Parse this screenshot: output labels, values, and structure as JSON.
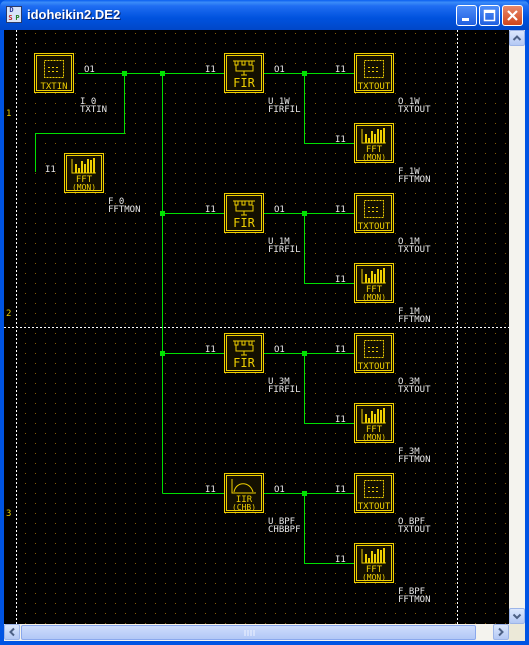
{
  "window": {
    "title": "idoheikin2.DE2"
  },
  "rulers": {
    "rows": [
      "1",
      "2",
      "3"
    ]
  },
  "blocks": [
    {
      "id": "txtin",
      "icon": "TXTIN",
      "name": "I_0",
      "type": "TXTIN",
      "in_port": "",
      "out_port": "O1"
    },
    {
      "id": "fft0",
      "icon_top": "FFT",
      "icon_sub": "(MON)",
      "name": "F_0",
      "type": "FFTMON",
      "in_port": "I1",
      "out_port": ""
    },
    {
      "id": "fir1w",
      "icon": "FIR",
      "name": "U_1W",
      "type": "FIRFIL",
      "in_port": "I1",
      "out_port": "O1"
    },
    {
      "id": "txt1w",
      "icon": "TXTOUT",
      "name": "O_1W",
      "type": "TXTOUT",
      "in_port": "I1",
      "out_port": ""
    },
    {
      "id": "fft1w",
      "icon_top": "FFT",
      "icon_sub": "(MON)",
      "name": "F_1W",
      "type": "FFTMON",
      "in_port": "I1",
      "out_port": ""
    },
    {
      "id": "fir1m",
      "icon": "FIR",
      "name": "U_1M",
      "type": "FIRFIL",
      "in_port": "I1",
      "out_port": "O1"
    },
    {
      "id": "txt1m",
      "icon": "TXTOUT",
      "name": "O_1M",
      "type": "TXTOUT",
      "in_port": "I1",
      "out_port": ""
    },
    {
      "id": "fft1m",
      "icon_top": "FFT",
      "icon_sub": "(MON)",
      "name": "F_1M",
      "type": "FFTMON",
      "in_port": "I1",
      "out_port": ""
    },
    {
      "id": "fir3m",
      "icon": "FIR",
      "name": "U_3M",
      "type": "FIRFIL",
      "in_port": "I1",
      "out_port": "O1"
    },
    {
      "id": "txt3m",
      "icon": "TXTOUT",
      "name": "O_3M",
      "type": "TXTOUT",
      "in_port": "I1",
      "out_port": ""
    },
    {
      "id": "fft3m",
      "icon_top": "FFT",
      "icon_sub": "(MON)",
      "name": "F_3M",
      "type": "FFTMON",
      "in_port": "I1",
      "out_port": ""
    },
    {
      "id": "iir",
      "icon_top": "IIR",
      "icon_sub": "(CHB)",
      "name": "U_BPF",
      "type": "CHBBPF",
      "in_port": "I1",
      "out_port": "O1"
    },
    {
      "id": "txtbpf",
      "icon": "TXTOUT",
      "name": "O_BPF",
      "type": "TXTOUT",
      "in_port": "I1",
      "out_port": ""
    },
    {
      "id": "fftbpf",
      "icon_top": "FFT",
      "icon_sub": "(MON)",
      "name": "F_BPF",
      "type": "FFTMON",
      "in_port": "I1",
      "out_port": ""
    }
  ],
  "colors": {
    "canvas": "#000000",
    "grid_dot": "#8a5a00",
    "wire": "#00e000",
    "block": "#f0d000",
    "block_fill": "#141000",
    "labels": "#e8e8e8",
    "ruler": "#e8d000"
  }
}
